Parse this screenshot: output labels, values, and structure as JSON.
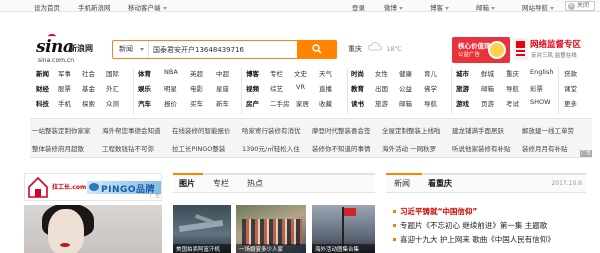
{
  "topbar": {
    "set_homepage": "设为首页",
    "mobile": "手机新浪网",
    "client": "移动客户端",
    "login": "登录",
    "weibo": "微博",
    "blog": "博客",
    "mail": "邮箱",
    "site_nav": "网站导航",
    "close": "关闭"
  },
  "logo": {
    "brand": "sina",
    "brand_cn": "新浪网",
    "domain": "sina.com.cn"
  },
  "search": {
    "category": "新闻",
    "value": "国泰君安开户13648439716"
  },
  "weather": {
    "city": "重庆",
    "temp": "18℃"
  },
  "ads": {
    "red_title": "核心价值观",
    "red_sub": "公益广告",
    "center_title": "网络监督专区",
    "center_sub": "反对三风 监督在线"
  },
  "nav": {
    "row1": [
      "新闻",
      "军事",
      "社会",
      "国际",
      "体育",
      "NBA",
      "英超",
      "中超",
      "博客",
      "专栏",
      "文史",
      "天气",
      "时尚",
      "女性",
      "健康",
      "育儿",
      "城市",
      "鲜城",
      "重庆",
      "English",
      "贷款"
    ],
    "row2": [
      "财经",
      "股票",
      "基金",
      "外汇",
      "娱乐",
      "明星",
      "电影",
      "星座",
      "视频",
      "综艺",
      "VR",
      "直播",
      "教育",
      "出国",
      "公益",
      "佛学",
      "房产",
      "二手房",
      "家居",
      "收藏",
      "读书",
      "旅游",
      "邮箱",
      "导航",
      "彩票",
      "开奖"
    ],
    "row3": [
      "科技",
      "手机",
      "探索",
      "众测",
      "汽车",
      "报价",
      "买车",
      "新车",
      "房产",
      "二手房",
      "家居",
      "收藏",
      "论坛",
      "书",
      "城市",
      "邮箱",
      "导航",
      "彩票",
      "游戏",
      "页游",
      "考试",
      "MORE"
    ],
    "more": "更多"
  },
  "nav_rows": {
    "r1": [
      "新闻",
      "军事",
      "社会",
      "国际",
      "体育",
      "NBA",
      "英超",
      "中超",
      "博客",
      "专栏",
      "文史",
      "天气",
      "时尚",
      "女性",
      "健康",
      "育儿",
      "城市",
      "鲜城",
      "重庆",
      "English",
      "贷款"
    ],
    "r2": [
      "财经",
      "股票",
      "基金",
      "外汇",
      "娱乐",
      "明星",
      "电影",
      "星座",
      "视频",
      "综艺",
      "VR",
      "直播",
      "教育",
      "出国",
      "公益",
      "佛学",
      "旅游",
      "邮箱",
      "导航",
      "彩票",
      "课堂"
    ],
    "r3": [
      "科技",
      "手机",
      "探索",
      "众测",
      "汽车",
      "报价",
      "买车",
      "新车",
      "房产",
      "二手房",
      "家居",
      "收藏",
      "读书",
      "旅游",
      "邮箱",
      "导航",
      "游戏",
      "页游",
      "考试",
      "SHOW",
      "更多"
    ]
  },
  "links": {
    "row1": [
      "一站整装定制你家家",
      "海外帮您事德会知道",
      "在线装修的智能报价",
      "哈家寄行装修有消优",
      "摩登时代整装喜会签",
      "全屋定制整装上线啦",
      "建龙铺满手面居跃",
      "解放建一线工单劳"
    ],
    "row2": [
      "整体装修府月超散",
      "工程数钱钻不可弥",
      "拉工长PINGO整装",
      "1390元/㎡轻松入住",
      "装修你不知道的事情",
      "海外活动 一网秋罗",
      "听说他家装修有补贴",
      "装修月月有补贴"
    ],
    "ad": "广告"
  },
  "left_ad": {
    "brand": "拉工长.com",
    "pingo": "PINGO品牌",
    "tag": "广告"
  },
  "mid": {
    "tabs": [
      "图片",
      "专栏",
      "热点"
    ],
    "captions": [
      "美国拍卖阿富汗机",
      "一场婚宴多少人家",
      "海外活动图集合集"
    ]
  },
  "right": {
    "tabs": [
      "新闻",
      "看重庆"
    ],
    "date": "2017.10.6",
    "news": [
      "习近平铸就“中国信仰”",
      "专题片《不忘初心 继续前进》第一集 主题歌",
      "喜迎十九大 护上网来 歌曲《中国人民有信仰》"
    ]
  }
}
